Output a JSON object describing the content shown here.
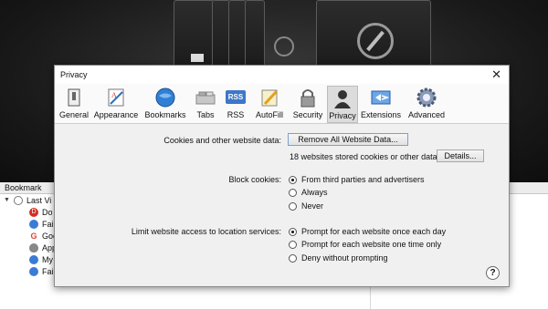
{
  "dialog": {
    "title": "Privacy",
    "close_glyph": "✕"
  },
  "toolbar": {
    "tabs": [
      {
        "label": "General",
        "icon": "general-switch-icon"
      },
      {
        "label": "Appearance",
        "icon": "appearance-brush-icon"
      },
      {
        "label": "Bookmarks",
        "icon": "bookmarks-globe-icon"
      },
      {
        "label": "Tabs",
        "icon": "tabs-icon"
      },
      {
        "label": "RSS",
        "icon": "rss-icon"
      },
      {
        "label": "AutoFill",
        "icon": "autofill-pencil-icon"
      },
      {
        "label": "Security",
        "icon": "security-lock-icon"
      },
      {
        "label": "Privacy",
        "icon": "privacy-person-icon",
        "active": true
      },
      {
        "label": "Extensions",
        "icon": "extensions-icon"
      },
      {
        "label": "Advanced",
        "icon": "advanced-gear-icon"
      }
    ],
    "rss_badge": "RSS"
  },
  "cookies": {
    "label": "Cookies and other website data:",
    "remove_button": "Remove All Website Data...",
    "stored_text": "18 websites stored cookies or other data",
    "details_button": "Details..."
  },
  "block_cookies": {
    "label": "Block cookies:",
    "options": [
      {
        "label": "From third parties and advertisers",
        "selected": true
      },
      {
        "label": "Always",
        "selected": false
      },
      {
        "label": "Never",
        "selected": false
      }
    ]
  },
  "location": {
    "label": "Limit website access to location services:",
    "options": [
      {
        "label": "Prompt for each website once each day",
        "selected": true
      },
      {
        "label": "Prompt for each website one time only",
        "selected": false
      },
      {
        "label": "Deny without prompting",
        "selected": false
      }
    ]
  },
  "help_glyph": "?",
  "background": {
    "bookmark_header": "Bookmark",
    "rows": [
      {
        "text": "Last Vi",
        "icon": "clock-icon"
      },
      {
        "text": "Do",
        "icon": "red-circle-icon"
      },
      {
        "text": "Fai",
        "icon": "safari-globe-icon"
      },
      {
        "text": "Goo",
        "icon": "google-icon"
      },
      {
        "text": "App",
        "icon": "apple-icon"
      },
      {
        "text": "My",
        "icon": "safari-globe-icon"
      },
      {
        "text": "Fai",
        "icon": "safari-globe-icon"
      }
    ],
    "google_glyph": "G",
    "apple_glyph": "",
    "red_glyph": "D"
  }
}
